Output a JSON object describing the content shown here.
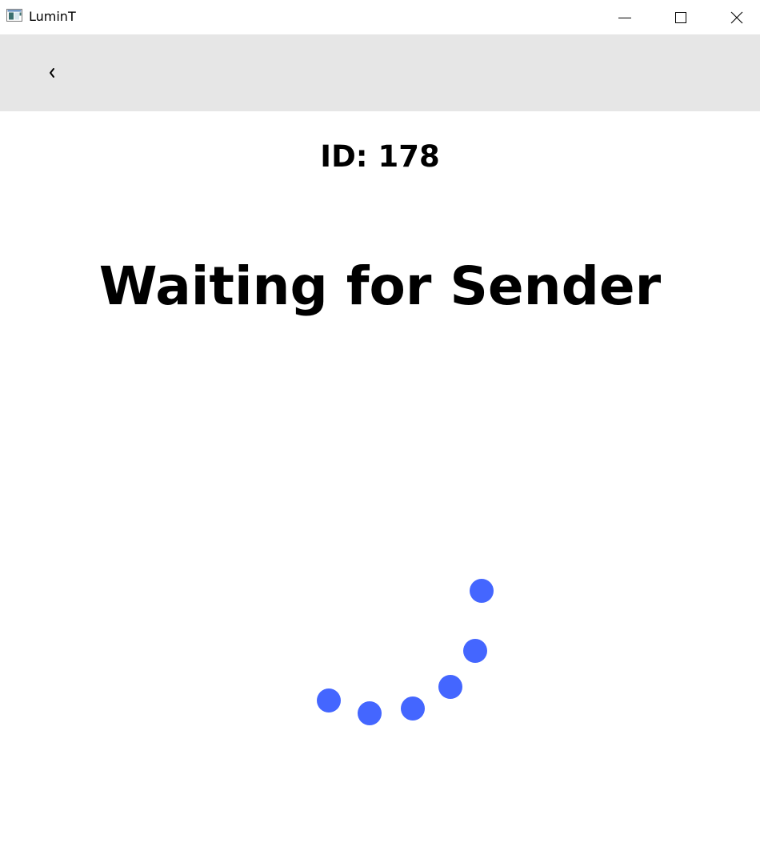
{
  "window": {
    "title": "LuminT",
    "icon": "app-window-icon",
    "controls": [
      "minimize-icon",
      "maximize-icon",
      "close-icon"
    ]
  },
  "toolbar": {
    "back_label": "‹",
    "back_icon": "chevron-left-icon"
  },
  "main": {
    "id_text": "ID: 178",
    "status_text": "Waiting for Sender"
  },
  "spinner": {
    "icon": "loading-spinner-icon",
    "color": "#4466ff",
    "dot_count": 6
  }
}
